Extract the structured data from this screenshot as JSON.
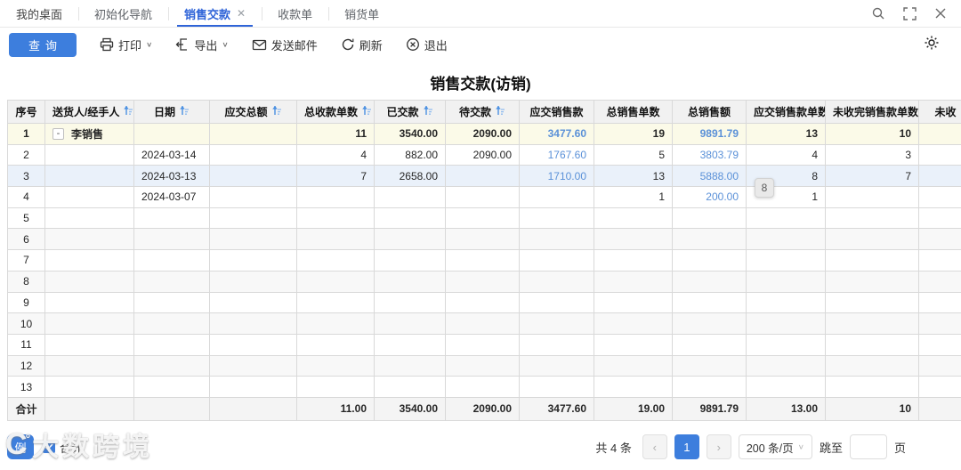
{
  "tabs": {
    "items": [
      {
        "label": "我的桌面",
        "active": false,
        "closable": false
      },
      {
        "label": "初始化导航",
        "active": false,
        "closable": false
      },
      {
        "label": "销售交款",
        "active": true,
        "closable": true
      },
      {
        "label": "收款单",
        "active": false,
        "closable": false
      },
      {
        "label": "销货单",
        "active": false,
        "closable": false
      }
    ],
    "close_glyph": "✕"
  },
  "toolbar": {
    "query_label": "查询",
    "print_label": "打印",
    "export_label": "导出",
    "send_email_label": "发送邮件",
    "refresh_label": "刷新",
    "exit_label": "退出"
  },
  "page": {
    "title": "销售交款(访销)"
  },
  "table": {
    "columns": [
      {
        "label": "序号",
        "sortable": false
      },
      {
        "label": "送货人/经手人",
        "sortable": true
      },
      {
        "label": "日期",
        "sortable": true
      },
      {
        "label": "应交总额",
        "sortable": true
      },
      {
        "label": "总收款单数",
        "sortable": true
      },
      {
        "label": "已交款",
        "sortable": true
      },
      {
        "label": "待交款",
        "sortable": true
      },
      {
        "label": "应交销售款",
        "sortable": false
      },
      {
        "label": "总销售单数",
        "sortable": false
      },
      {
        "label": "总销售额",
        "sortable": false
      },
      {
        "label": "应交销售款单数",
        "sortable": false
      },
      {
        "label": "未收完销售款单数",
        "sortable": false
      },
      {
        "label": "未收",
        "sortable": false
      }
    ],
    "rows": [
      {
        "variant": "group",
        "collapse": "-",
        "cells": [
          "1",
          "李销售",
          "",
          "",
          "11",
          "3540.00",
          "2090.00",
          "3477.60",
          "19",
          "9891.79",
          "13",
          "10",
          ""
        ]
      },
      {
        "variant": "",
        "cells": [
          "2",
          "",
          "2024-03-14",
          "",
          "4",
          "882.00",
          "2090.00",
          "1767.60",
          "5",
          "3803.79",
          "4",
          "3",
          ""
        ]
      },
      {
        "variant": "selected",
        "cells": [
          "3",
          "",
          "2024-03-13",
          "",
          "7",
          "2658.00",
          "",
          "1710.00",
          "13",
          "5888.00",
          "8",
          "7",
          ""
        ]
      },
      {
        "variant": "",
        "cells": [
          "4",
          "",
          "2024-03-07",
          "",
          "",
          "",
          "",
          "",
          "1",
          "200.00",
          "1",
          "",
          ""
        ]
      },
      {
        "variant": "",
        "cells": [
          "5",
          "",
          "",
          "",
          "",
          "",
          "",
          "",
          "",
          "",
          "",
          "",
          ""
        ]
      },
      {
        "variant": "striped",
        "cells": [
          "6",
          "",
          "",
          "",
          "",
          "",
          "",
          "",
          "",
          "",
          "",
          "",
          ""
        ]
      },
      {
        "variant": "",
        "cells": [
          "7",
          "",
          "",
          "",
          "",
          "",
          "",
          "",
          "",
          "",
          "",
          "",
          ""
        ]
      },
      {
        "variant": "striped",
        "cells": [
          "8",
          "",
          "",
          "",
          "",
          "",
          "",
          "",
          "",
          "",
          "",
          "",
          ""
        ]
      },
      {
        "variant": "",
        "cells": [
          "9",
          "",
          "",
          "",
          "",
          "",
          "",
          "",
          "",
          "",
          "",
          "",
          ""
        ]
      },
      {
        "variant": "striped",
        "cells": [
          "10",
          "",
          "",
          "",
          "",
          "",
          "",
          "",
          "",
          "",
          "",
          "",
          ""
        ]
      },
      {
        "variant": "",
        "cells": [
          "11",
          "",
          "",
          "",
          "",
          "",
          "",
          "",
          "",
          "",
          "",
          "",
          ""
        ]
      },
      {
        "variant": "striped",
        "cells": [
          "12",
          "",
          "",
          "",
          "",
          "",
          "",
          "",
          "",
          "",
          "",
          "",
          ""
        ]
      },
      {
        "variant": "",
        "cells": [
          "13",
          "",
          "",
          "",
          "",
          "",
          "",
          "",
          "",
          "",
          "",
          "",
          ""
        ]
      }
    ],
    "summary": {
      "cells": [
        "合计",
        "",
        "",
        "",
        "11.00",
        "3540.00",
        "2090.00",
        "3477.60",
        "19.00",
        "9891.79",
        "13.00",
        "10",
        ""
      ]
    },
    "floating_badge": "8"
  },
  "footer": {
    "legend_button_label": "例",
    "totals_checkbox_label": "合计",
    "totals_checked": true,
    "pagination": {
      "total_text": "共 4 条",
      "prev_glyph": "‹",
      "next_glyph": "›",
      "current_page": "1",
      "page_size_label": "200 条/页",
      "jump_prefix": "跳至",
      "jump_suffix": "页",
      "jump_value": ""
    }
  },
  "watermark": {
    "logo": "C",
    "degree": "°",
    "text": "大数跨境"
  },
  "colors": {
    "accent": "#3d7edd",
    "link": "#5b91d8",
    "group_row_bg": "#fbfae8",
    "selected_row_bg": "#eaf1fa"
  }
}
